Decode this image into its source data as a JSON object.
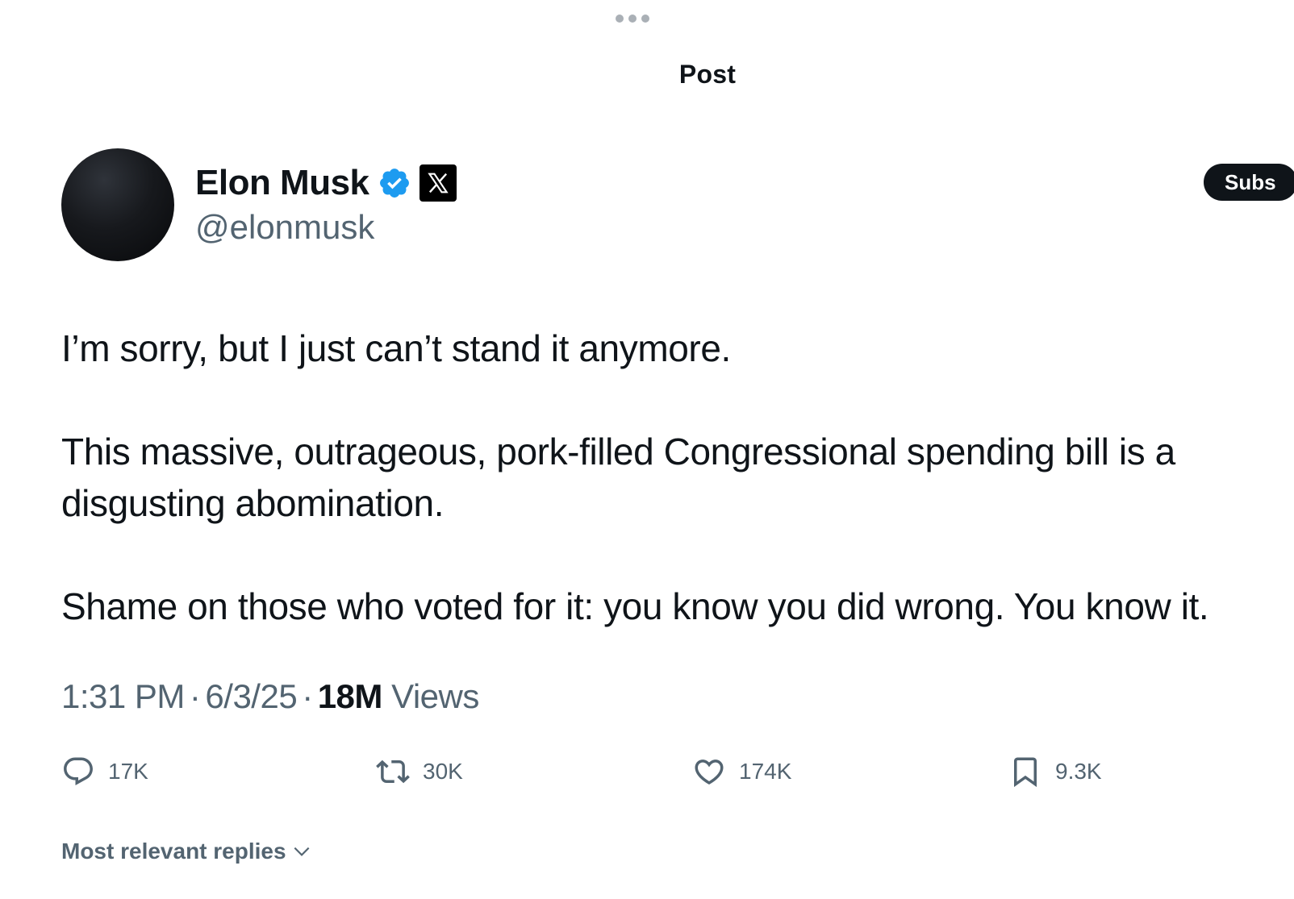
{
  "header": {
    "title": "Post"
  },
  "author": {
    "display_name": "Elon Musk",
    "handle": "@elonmusk",
    "verified": true,
    "affiliate_badge": "x-logo-icon"
  },
  "subscribe_button": {
    "label": "Subs"
  },
  "post": {
    "paragraphs": [
      "I’m sorry, but I just can’t stand it anymore.",
      "This massive, outrageous, pork-filled Congressional spending bill is a disgusting abomination.",
      "Shame on those who voted for it: you know you did wrong. You know it."
    ]
  },
  "meta": {
    "time": "1:31 PM",
    "separator": "·",
    "date": "6/3/25",
    "views_count": "18M",
    "views_label": "Views"
  },
  "actions": {
    "replies": "17K",
    "reposts": "30K",
    "likes": "174K",
    "bookmarks": "9.3K"
  },
  "replies_sort": {
    "label": "Most relevant replies"
  },
  "colors": {
    "text_primary": "#0f1419",
    "text_secondary": "#536471",
    "verified_blue": "#1d9bf0",
    "dots_gray": "#aab0b6"
  }
}
